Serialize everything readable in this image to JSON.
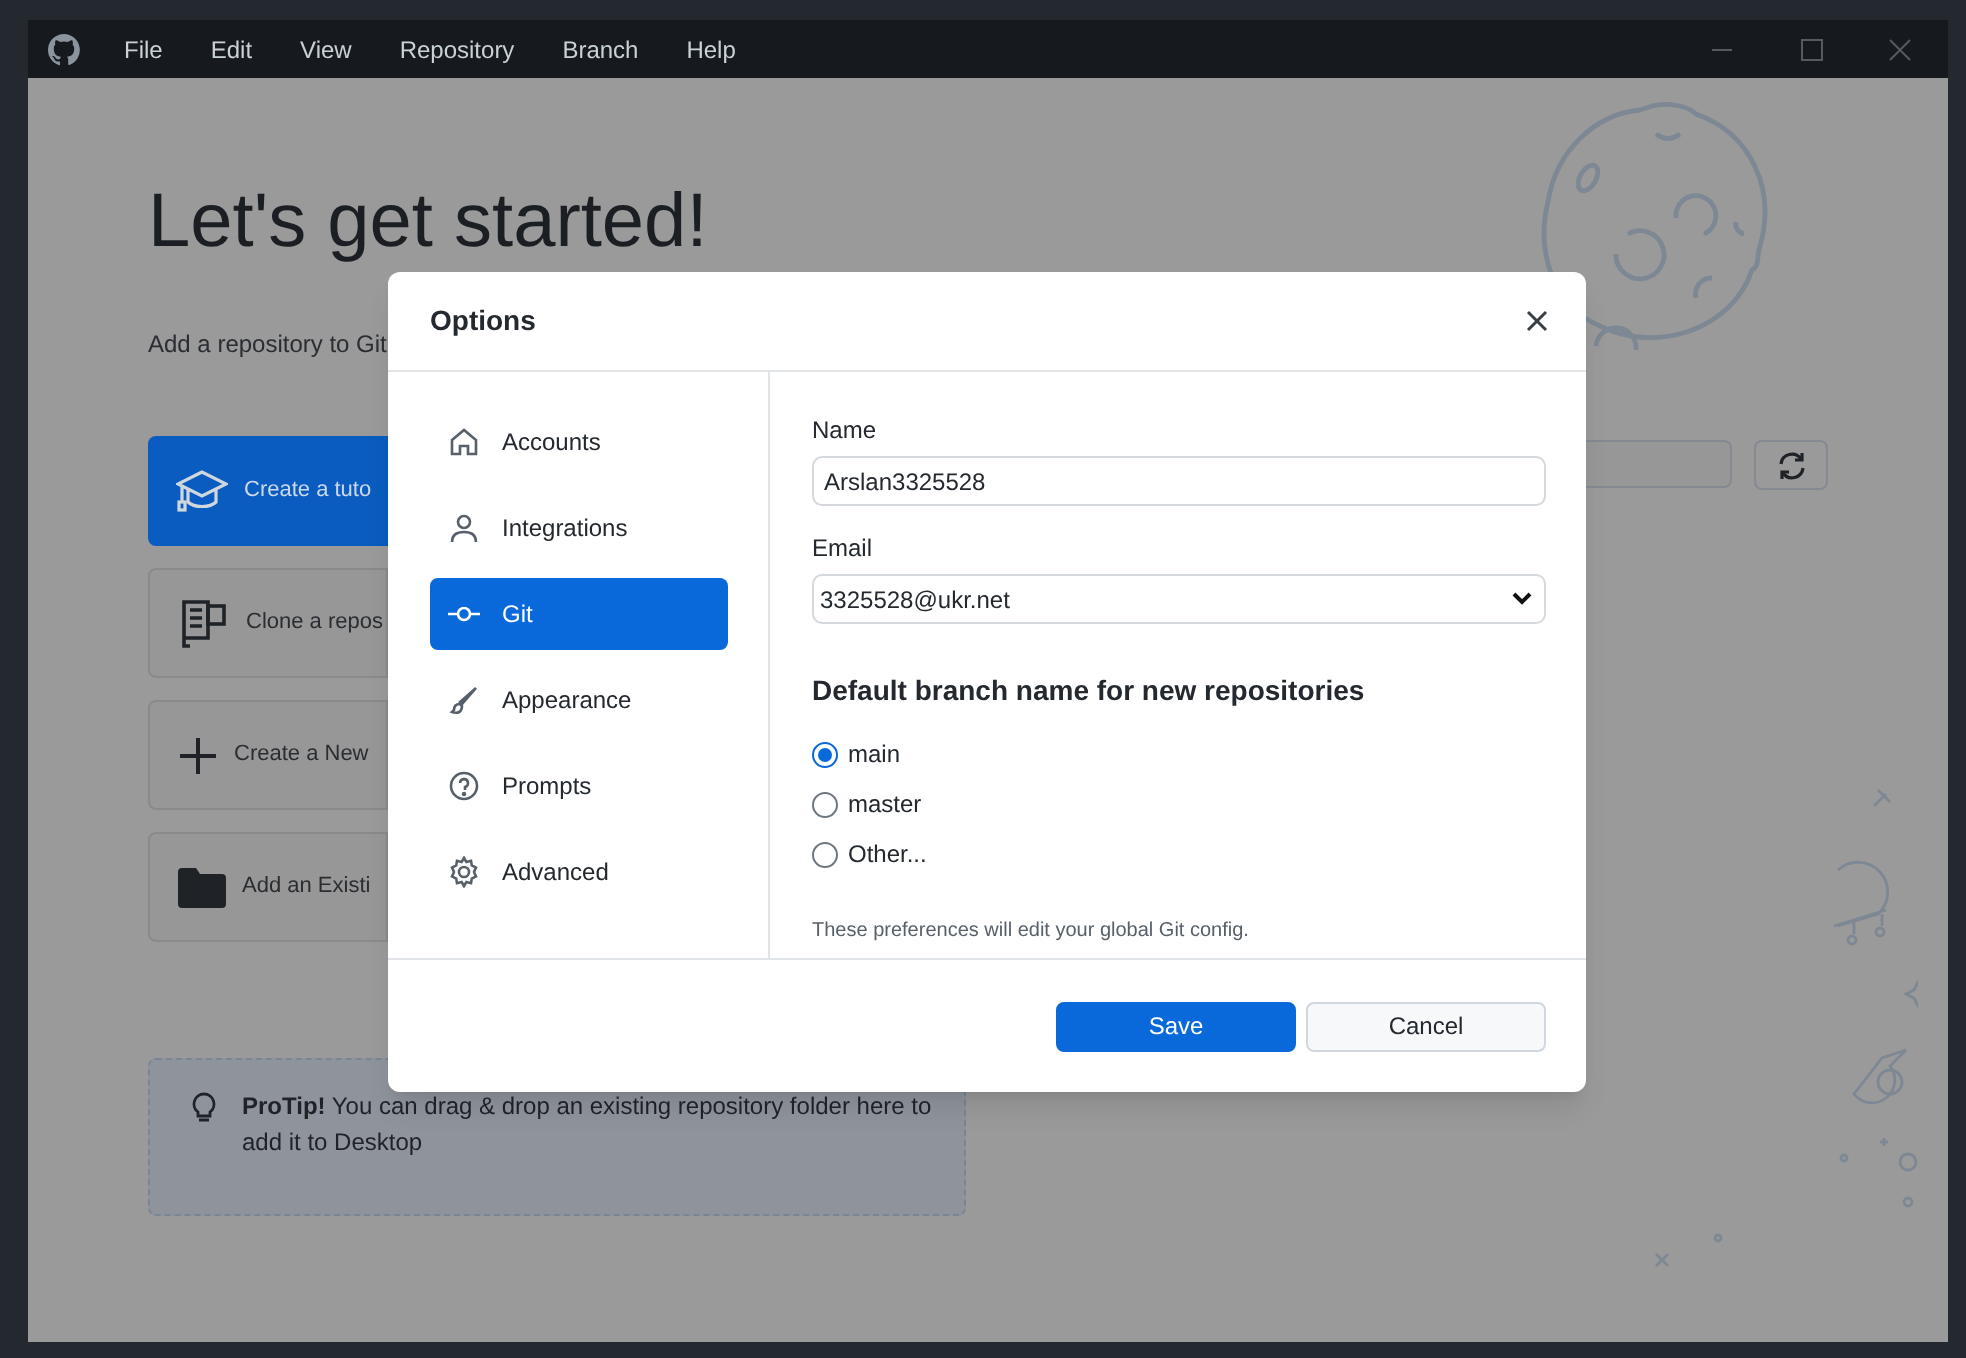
{
  "menu_bar": {
    "items": [
      "File",
      "Edit",
      "View",
      "Repository",
      "Branch",
      "Help"
    ]
  },
  "welcome": {
    "title": "Let's get started!",
    "subtitle": "Add a repository to Git",
    "actions": [
      {
        "label": "Create a tuto",
        "kind": "tutorial",
        "primary": true
      },
      {
        "label": "Clone a repos",
        "kind": "clone",
        "primary": false
      },
      {
        "label": "Create a New",
        "kind": "new",
        "primary": false
      },
      {
        "label": "Add an Existi",
        "kind": "existing",
        "primary": false
      }
    ],
    "protip": "**ProTip!** You can drag & drop an existing repository folder here to add it to Desktop"
  },
  "dialog": {
    "title": "Options",
    "nav": [
      {
        "label": "Accounts",
        "kind": "home",
        "selected": false
      },
      {
        "label": "Integrations",
        "kind": "person",
        "selected": false
      },
      {
        "label": "Git",
        "kind": "commit",
        "selected": true
      },
      {
        "label": "Appearance",
        "kind": "brush",
        "selected": false
      },
      {
        "label": "Prompts",
        "kind": "question",
        "selected": false
      },
      {
        "label": "Advanced",
        "kind": "gear",
        "selected": false
      }
    ],
    "name_label": "Name",
    "name_value": "Arslan3325528",
    "email_label": "Email",
    "email_value": "3325528@ukr.net",
    "branch_heading": "Default branch name for new repositories",
    "branch_options": [
      {
        "label": "main",
        "selected": true
      },
      {
        "label": "master",
        "selected": false
      },
      {
        "label": "Other...",
        "selected": false
      }
    ],
    "note": "These preferences will edit your global Git config.",
    "buttons": [
      {
        "label": "Save",
        "kind": "primary"
      },
      {
        "label": "Cancel",
        "kind": "secondary"
      }
    ]
  }
}
